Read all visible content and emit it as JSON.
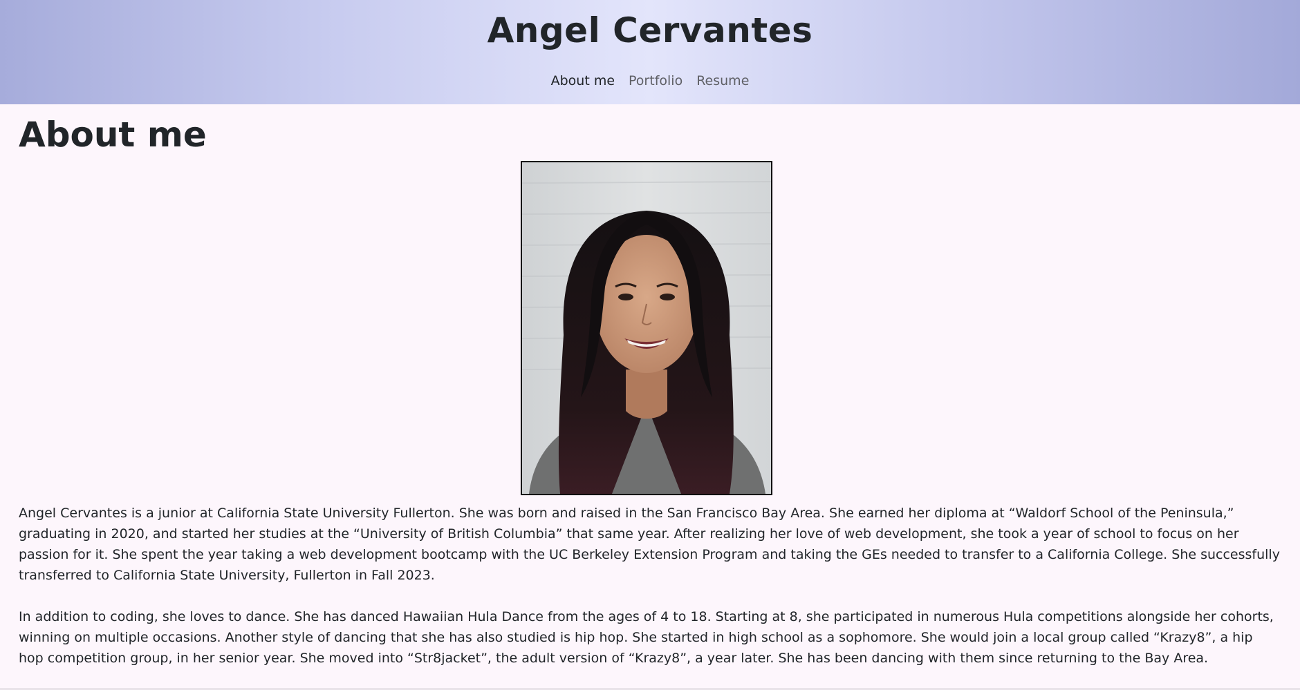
{
  "site": {
    "title": "Angel Cervantes"
  },
  "nav": {
    "items": [
      {
        "label": "About me",
        "active": true
      },
      {
        "label": "Portfolio",
        "active": false
      },
      {
        "label": "Resume",
        "active": false
      }
    ]
  },
  "main": {
    "heading": "About me",
    "photo_icon": "portrait-photo",
    "paragraphs": [
      "Angel Cervantes is a junior at California State University Fullerton. She was born and raised in the San Francisco Bay Area. She earned her diploma at “Waldorf School of the Peninsula,” graduating in 2020, and started her studies at the “University of British Columbia” that same year. After realizing her love of web development, she took a year of school to focus on her passion for it. She spent the year taking a web development bootcamp with the UC Berkeley Extension Program and taking the GEs needed to transfer to a California College. She successfully transferred to California State University, Fullerton in Fall 2023.",
      "In addition to coding, she loves to dance. She has danced Hawaiian Hula Dance from the ages of 4 to 18. Starting at 8, she participated in numerous Hula competitions alongside her cohorts, winning on multiple occasions. Another style of dancing that she has also studied is hip hop. She started in high school as a sophomore. She would join a local group called “Krazy8”, a hip hop competition group, in her senior year. She moved into “Str8jacket”, the adult version of “Krazy8”, a year later. She has been dancing with them since returning to the Bay Area."
    ]
  },
  "colors": {
    "background": "#fdf6fc",
    "header_gradient_edge": "#a6acdb",
    "header_gradient_center": "#e3e5fb",
    "text": "#212529",
    "nav_inactive": "#5f6066"
  }
}
